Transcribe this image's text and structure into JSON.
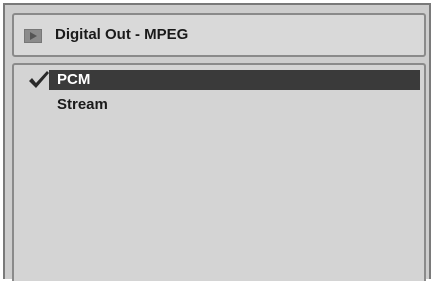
{
  "header": {
    "title": "Digital Out - MPEG",
    "icon": "play-icon"
  },
  "menu": {
    "options": [
      {
        "label": "PCM",
        "selected": true
      },
      {
        "label": "Stream",
        "selected": false
      }
    ],
    "checkmark_icon": "checkmark-icon"
  },
  "colors": {
    "screen_bg": "#cdcdcd",
    "highlight_bg": "#3a3a3a",
    "highlight_text": "#ffffff",
    "text": "#1a1a1a"
  }
}
